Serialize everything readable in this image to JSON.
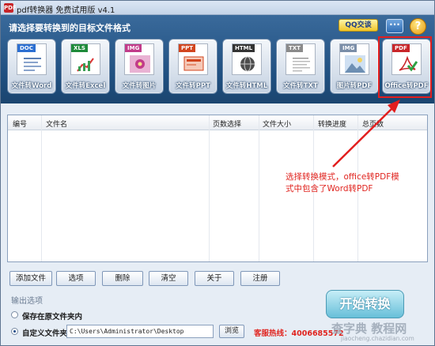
{
  "window": {
    "title": "pdf转换器 免费试用版 v4.1",
    "app_icon": "PDF"
  },
  "banner": {
    "label": "请选择要转换到的目标文件格式",
    "qq_label": "QQ交谈",
    "chat_icon": "chat-bubble-icon",
    "help_icon": "help-icon",
    "help_glyph": "?",
    "chat_glyph": "···"
  },
  "tiles": [
    {
      "tag": "DOC",
      "label": "文件转Word",
      "color": "#2c6fd1"
    },
    {
      "tag": "XLS",
      "label": "文件转Excel",
      "color": "#1e8a3a"
    },
    {
      "tag": "IMG",
      "label": "文件转图片",
      "color": "#c23b8a"
    },
    {
      "tag": "PPT",
      "label": "文件转PPT",
      "color": "#d2461f"
    },
    {
      "tag": "HTML",
      "label": "文件转HTML",
      "color": "#333333"
    },
    {
      "tag": "TXT",
      "label": "文件转TXT",
      "color": "#8a8a8a"
    },
    {
      "tag": "IMG",
      "label": "图片转PDF",
      "color": "#7a8ea8"
    },
    {
      "tag": "PDF",
      "label": "Office转PDF",
      "color": "#c8262a"
    }
  ],
  "list": {
    "columns": [
      "编号",
      "文件名",
      "页数选择",
      "文件大小",
      "转换进度",
      "总页数"
    ]
  },
  "annotation": {
    "line1": "选择转换模式，office转PDF模",
    "line2": "式中包含了Word转PDF"
  },
  "actions": {
    "add_file": "添加文件",
    "options": "选项",
    "delete": "删除",
    "clear": "清空",
    "about": "关于",
    "register": "注册"
  },
  "output": {
    "section_label": "输出选项",
    "keep_original_label": "保存在原文件夹内",
    "custom_folder_label": "自定义文件夹",
    "custom_folder_path": "C:\\Users\\Administrator\\Desktop",
    "browse_label": "浏览",
    "selected": "custom"
  },
  "hotline": "客服热线：4006685572",
  "start_label": "开始转换",
  "watermark": {
    "main": "查字典 教程网",
    "sub": "jiaocheng.chazidian.com"
  }
}
